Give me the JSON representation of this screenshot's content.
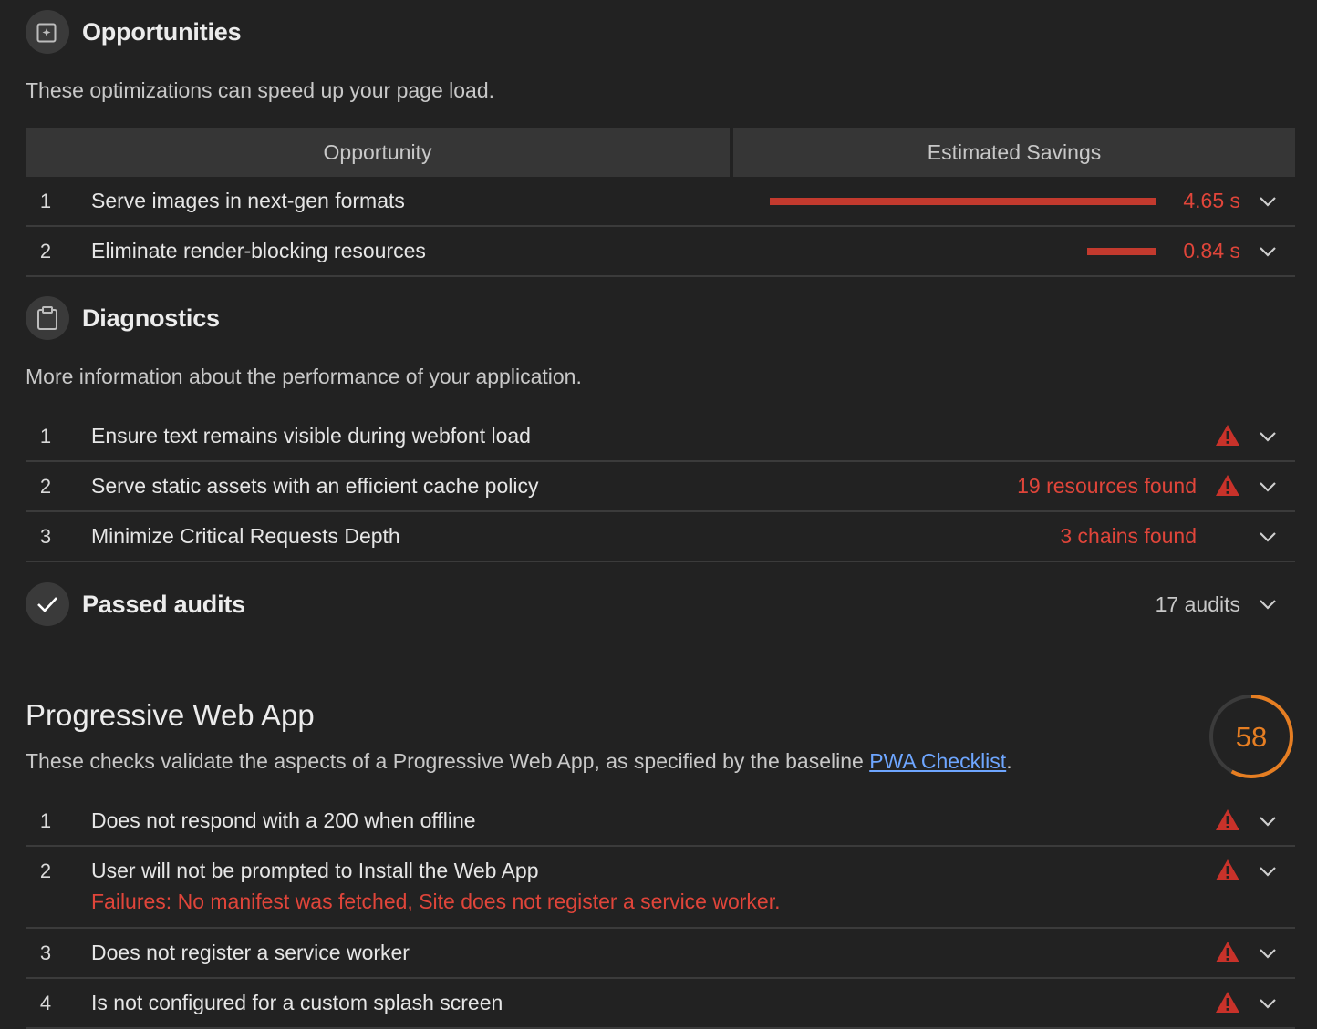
{
  "opportunities": {
    "title": "Opportunities",
    "description": "These optimizations can speed up your page load.",
    "col_opportunity": "Opportunity",
    "col_savings": "Estimated Savings",
    "items": [
      {
        "num": "1",
        "title": "Serve images in next-gen formats",
        "savings": "4.65 s"
      },
      {
        "num": "2",
        "title": "Eliminate render-blocking resources",
        "savings": "0.84 s"
      }
    ]
  },
  "diagnostics": {
    "title": "Diagnostics",
    "description": "More information about the performance of your application.",
    "items": [
      {
        "num": "1",
        "title": "Ensure text remains visible during webfont load",
        "detail": ""
      },
      {
        "num": "2",
        "title": "Serve static assets with an efficient cache policy",
        "detail": "19 resources found"
      },
      {
        "num": "3",
        "title": "Minimize Critical Requests Depth",
        "detail": "3 chains found"
      }
    ]
  },
  "passed": {
    "title": "Passed audits",
    "count": "17 audits"
  },
  "pwa": {
    "title": "Progressive Web App",
    "description_prefix": "These checks validate the aspects of a Progressive Web App, as specified by the baseline ",
    "link_text": "PWA Checklist",
    "description_suffix": ".",
    "score": "58",
    "score_fraction": 0.58,
    "items": [
      {
        "num": "1",
        "title": "Does not respond with a 200 when offline"
      },
      {
        "num": "2",
        "title": "User will not be prompted to Install the Web App",
        "failure": "Failures: No manifest was fetched, Site does not register a service worker."
      },
      {
        "num": "3",
        "title": "Does not register a service worker"
      },
      {
        "num": "4",
        "title": "Is not configured for a custom splash screen"
      }
    ]
  },
  "colors": {
    "fail": "#e0453a",
    "average": "#e67e22",
    "background": "#222222",
    "link": "#6ea6ff"
  }
}
